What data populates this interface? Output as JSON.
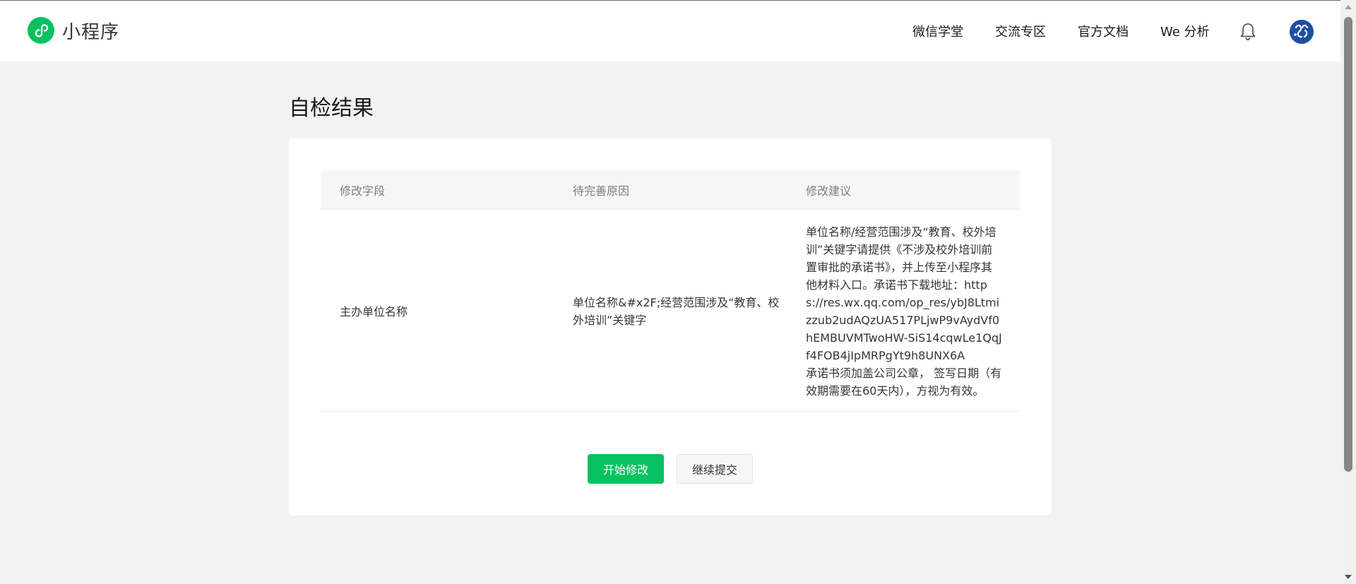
{
  "header": {
    "logo_text": "小程序",
    "nav": [
      "微信学堂",
      "交流专区",
      "官方文档",
      "We 分析"
    ]
  },
  "main": {
    "title": "自检结果",
    "table": {
      "columns": [
        "修改字段",
        "待完善原因",
        "修改建议"
      ],
      "rows": [
        {
          "field": "主办单位名称",
          "reason": "单位名称&#x2F;经营范围涉及“教育、校外培训”关键字",
          "suggestion_text": "单位名称/经营范围涉及“教育、校外培训”关键字请提供《不涉及校外培训前置审批的承诺书》，并上传至小程序其他材料入口。承诺书下载地址：https://res.wx.qq.com/op_res/ybJ8Ltmizzub2udAQzUA517PLjwP9vAydVf0hEMBUVMTwoHW-SiS14cqwLe1QqJf4FOB4jIpMRPgYt9h8UNX6A",
          "suggestion_note": "承诺书须加盖公司公章， 签写日期（有效期需要在60天内），方视为有效。"
        }
      ]
    },
    "buttons": {
      "primary": "开始修改",
      "secondary": "继续提交"
    }
  },
  "colors": {
    "brand_green": "#07c160",
    "page_bg": "#f2f2f2",
    "avatar_blue": "#1d4fa5"
  },
  "icons": {
    "logo": "mini-program-logo-icon",
    "bell": "bell-icon",
    "avatar": "user-avatar"
  }
}
